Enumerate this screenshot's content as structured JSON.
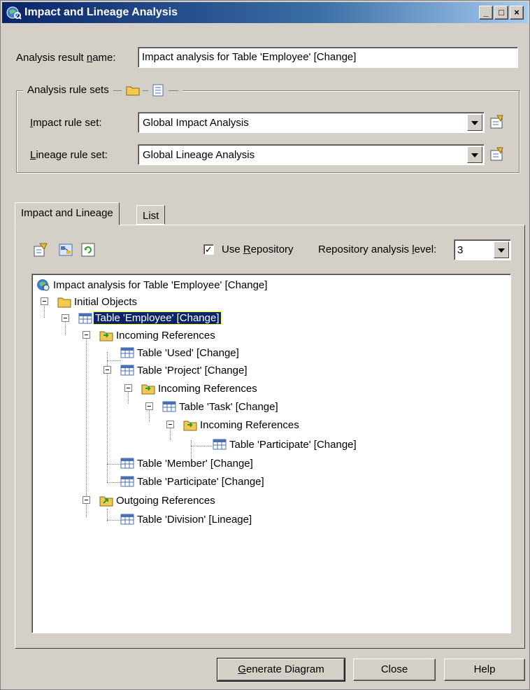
{
  "window": {
    "title": "Impact and Lineage Analysis",
    "minimize": "_",
    "maximize": "□",
    "close": "×"
  },
  "result_name": {
    "label_pre": "Analysis result ",
    "label_u": "n",
    "label_post": "ame:",
    "value": "Impact analysis for Table 'Employee' [Change]"
  },
  "rule_sets": {
    "legend": "Analysis rule sets",
    "impact_label_u": "I",
    "impact_label_post": "mpact rule set:",
    "impact_value": "Global Impact Analysis",
    "lineage_label_u": "L",
    "lineage_label_post": "ineage rule set:",
    "lineage_value": "Global Lineage Analysis"
  },
  "tabs": [
    "Impact and Lineage",
    "List"
  ],
  "options": {
    "use_repository_checked": true,
    "use_repository_pre": "Use ",
    "use_repository_u": "R",
    "use_repository_post": "epository",
    "level_label_pre": "Repository analysis ",
    "level_label_u": "l",
    "level_label_post": "evel:",
    "level_value": "3"
  },
  "tree": {
    "root": "Impact analysis for Table 'Employee' [Change]",
    "initial_objects": "Initial Objects",
    "employee": "Table 'Employee' [Change]",
    "incoming_1": "Incoming References",
    "used": "Table 'Used' [Change]",
    "project": "Table 'Project' [Change]",
    "incoming_2": "Incoming References",
    "task": "Table 'Task' [Change]",
    "incoming_3": "Incoming References",
    "participate_1": "Table 'Participate' [Change]",
    "member": "Table 'Member' [Change]",
    "participate_2": "Table 'Participate' [Change]",
    "outgoing": "Outgoing References",
    "division": "Table 'Division' [Lineage]"
  },
  "buttons": {
    "generate_u": "G",
    "generate_post": "enerate Diagram",
    "close": "Close",
    "help": "Help"
  },
  "colors": {
    "title_active": "#0a246a",
    "dialog_face": "#d4d0c8",
    "selection": "#0a246a"
  }
}
